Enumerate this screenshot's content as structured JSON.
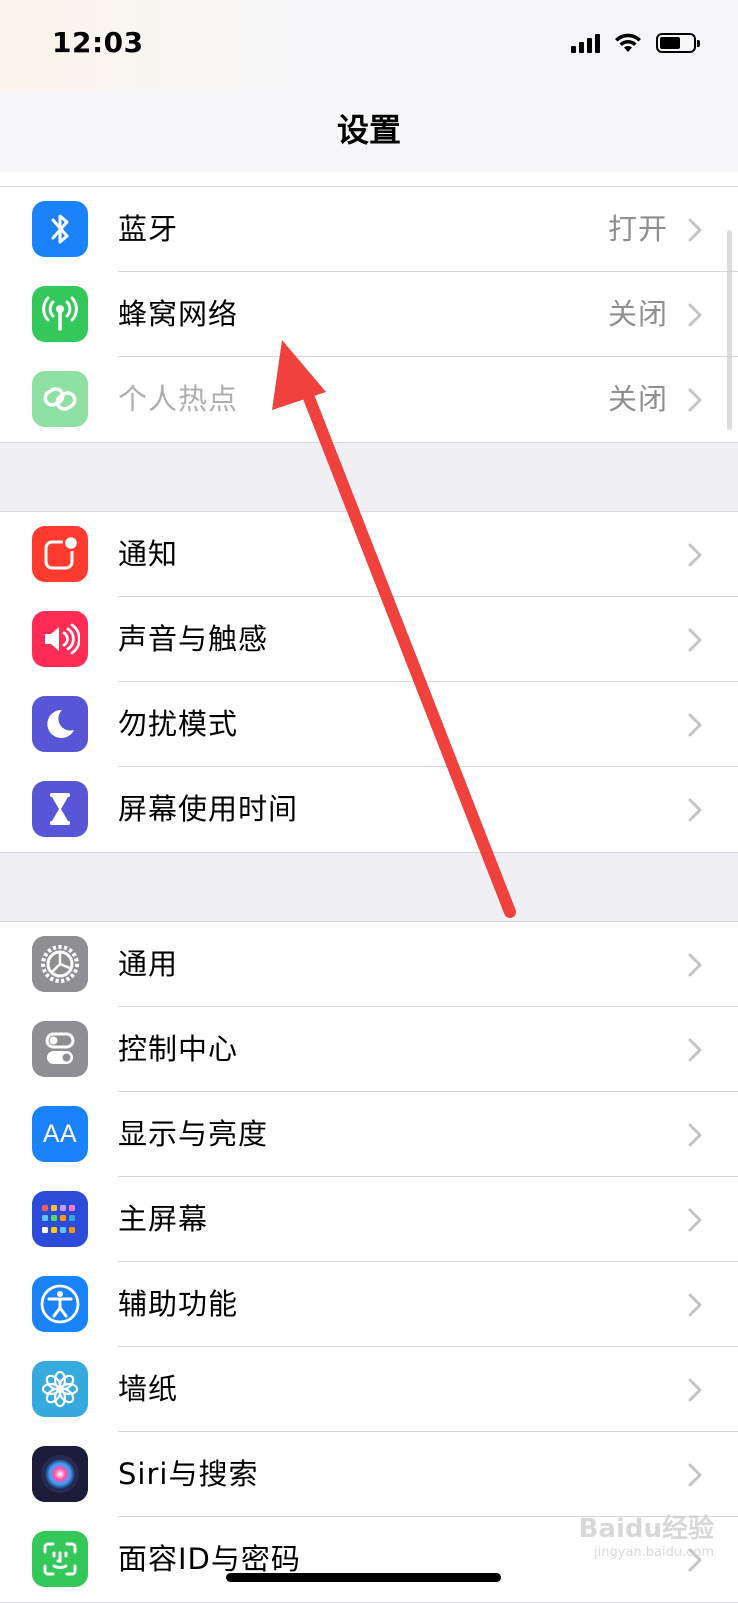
{
  "status_bar": {
    "time": "12:03"
  },
  "nav": {
    "title": "设置"
  },
  "groups": [
    {
      "rows": [
        {
          "label": "蓝牙",
          "value": "打开",
          "icon": "bluetooth-icon",
          "color": "#1a82fb"
        },
        {
          "label": "蜂窝网络",
          "value": "关闭",
          "icon": "cellular-antenna-icon",
          "color": "#34c759"
        },
        {
          "label": "个人热点",
          "value": "关闭",
          "icon": "personal-hotspot-icon",
          "color": "#34c759"
        }
      ]
    },
    {
      "rows": [
        {
          "label": "通知",
          "icon": "notifications-icon",
          "color": "#ff3b30"
        },
        {
          "label": "声音与触感",
          "icon": "speaker-icon",
          "color": "#ff2d55"
        },
        {
          "label": "勿扰模式",
          "icon": "moon-icon",
          "color": "#5856d6"
        },
        {
          "label": "屏幕使用时间",
          "icon": "hourglass-icon",
          "color": "#5856d6"
        }
      ]
    },
    {
      "rows": [
        {
          "label": "通用",
          "icon": "gear-icon",
          "color": "#8e8e93"
        },
        {
          "label": "控制中心",
          "icon": "toggles-icon",
          "color": "#8e8e93"
        },
        {
          "label": "显示与亮度",
          "icon": "text-size-icon",
          "color": "#1a82fb"
        },
        {
          "label": "主屏幕",
          "icon": "home-screen-grid-icon",
          "color": "#2c4bd8"
        },
        {
          "label": "辅助功能",
          "icon": "accessibility-icon",
          "color": "#1a82fb"
        },
        {
          "label": "墙纸",
          "icon": "flower-icon",
          "color": "#36aadc"
        },
        {
          "label": "Siri与搜索",
          "icon": "siri-icon",
          "color": "#1c1c3a"
        },
        {
          "label": "面容ID与密码",
          "icon": "face-id-icon",
          "color": "#34c759"
        }
      ]
    }
  ],
  "icon_text": {
    "display": "AA"
  },
  "watermark": {
    "brand": "Baidu经验",
    "url": "jingyan.baidu.com"
  },
  "annotation": {
    "arrow_color": "#f0413c"
  }
}
